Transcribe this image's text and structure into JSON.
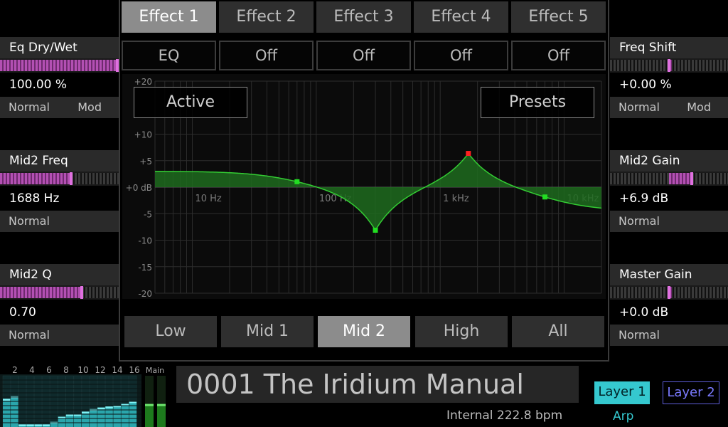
{
  "tabs": [
    "Effect 1",
    "Effect 2",
    "Effect 3",
    "Effect 4",
    "Effect 5"
  ],
  "active_tab": 0,
  "effect_slots": [
    "EQ",
    "Off",
    "Off",
    "Off",
    "Off"
  ],
  "overlay": {
    "active_label": "Active",
    "presets_label": "Presets"
  },
  "bands": [
    "Low",
    "Mid 1",
    "Mid 2",
    "High",
    "All"
  ],
  "active_band": 2,
  "left_params": [
    {
      "label": "Eq Dry/Wet",
      "value": "100.00 %",
      "mode": "Normal",
      "mod": "Mod",
      "level": 1.0,
      "bipolar": false
    },
    {
      "label": "Mid2 Freq",
      "value": "1688 Hz",
      "mode": "Normal",
      "mod": "",
      "level": 0.6,
      "bipolar": false
    },
    {
      "label": "Mid2 Q",
      "value": "0.70",
      "mode": "Normal",
      "mod": "",
      "level": 0.69,
      "bipolar": false
    }
  ],
  "right_params": [
    {
      "label": "Freq Shift",
      "value": "+0.00 %",
      "mode": "Normal",
      "mod": "Mod",
      "level": 0.5,
      "bipolar": true
    },
    {
      "label": "Mid2 Gain",
      "value": "+6.9 dB",
      "mode": "Normal",
      "mod": "",
      "level": 0.69,
      "bipolar": true
    },
    {
      "label": "Master Gain",
      "value": "+0.0 dB",
      "mode": "Normal",
      "mod": "",
      "level": 0.5,
      "bipolar": true
    }
  ],
  "eq": {
    "y_ticks": [
      "+20",
      "+10",
      "+5",
      "+0 dB",
      "-5",
      "-10",
      "-15",
      "-20"
    ],
    "y_values": [
      20,
      10,
      5,
      0,
      -5,
      -10,
      -15,
      -20
    ],
    "freq_labels": [
      "10 Hz",
      "100 Hz",
      "1 kHz",
      "10 kHz"
    ],
    "nodes": [
      {
        "name": "low",
        "freq": 70,
        "gain": 3,
        "color": "#22dd22"
      },
      {
        "name": "mid1",
        "freq": 300,
        "gain": -8.5,
        "color": "#22dd22"
      },
      {
        "name": "mid2",
        "freq": 1688,
        "gain": 6.9,
        "color": "#ff2020"
      },
      {
        "name": "high",
        "freq": 7000,
        "gain": -4.5,
        "color": "#22dd22"
      }
    ]
  },
  "meters": {
    "channel_labels": [
      "2",
      "4",
      "6",
      "8",
      "10",
      "12",
      "14",
      "16"
    ],
    "main_label": "Main",
    "levels": [
      0.55,
      0.6,
      0.05,
      0.05,
      0.05,
      0.05,
      0.1,
      0.2,
      0.25,
      0.25,
      0.3,
      0.35,
      0.38,
      0.4,
      0.42,
      0.45,
      0.5
    ],
    "main_levels": [
      0.45,
      0.45
    ]
  },
  "patch": {
    "name": "0001 The Iridium Manual",
    "tempo": "Internal 222.8 bpm"
  },
  "layers": {
    "layer1": "Layer 1",
    "layer2": "Layer 2",
    "arp": "Arp"
  },
  "colors": {
    "accent_cyan": "#35c8cf",
    "slider_purple": "#b350b3",
    "eq_fill": "#1f6b1f",
    "eq_line": "#33cc33"
  }
}
